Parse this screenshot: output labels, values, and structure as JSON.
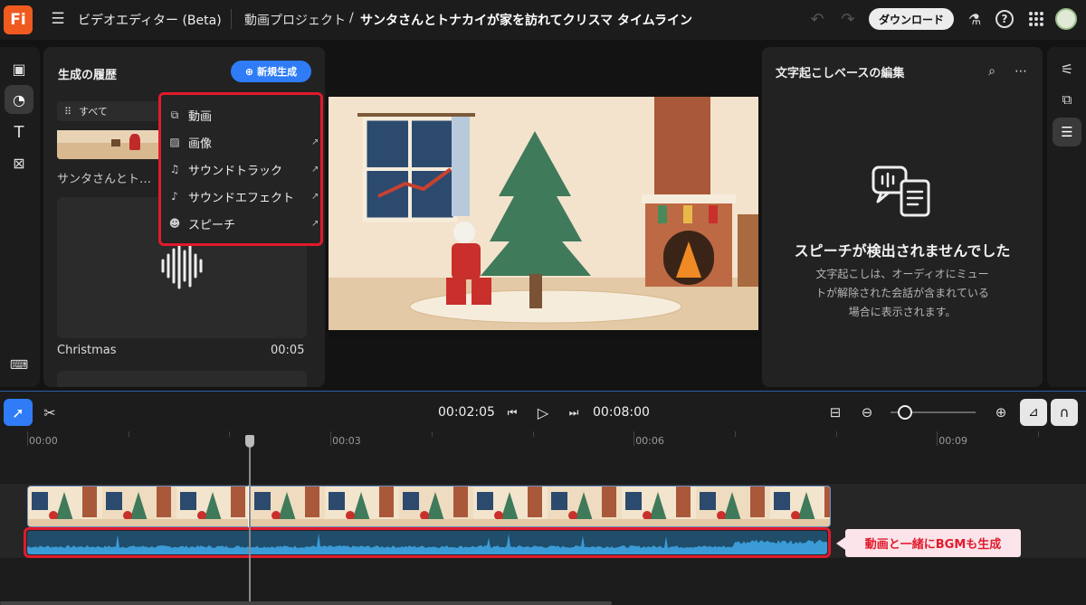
{
  "topbar": {
    "logo": "Fi",
    "app_title": "ビデオエディター (Beta)",
    "project_path": "動画プロジェクト",
    "separator": "/",
    "project_name": "サンタさんとトナカイが家を訪れてクリスマ タイムライン",
    "download_label": "ダウンロード"
  },
  "left_panel": {
    "title": "生成の履歴",
    "new_button_label": "新規生成",
    "filter_label": "すべて",
    "item1_title": "サンタさんとト…",
    "item2_title": "Christmas",
    "item2_duration": "00:05"
  },
  "dropdown": {
    "items": [
      {
        "label": "動画",
        "icon": "video-plus-icon"
      },
      {
        "label": "画像",
        "icon": "image-icon"
      },
      {
        "label": "サウンドトラック",
        "icon": "music-note-icon"
      },
      {
        "label": "サウンドエフェクト",
        "icon": "sparkle-note-icon"
      },
      {
        "label": "スピーチ",
        "icon": "people-icon"
      }
    ]
  },
  "right_panel": {
    "title": "文字起こしベースの編集",
    "empty_title": "スピーチが検出されませんでした",
    "empty_desc_line1": "文字起こしは、オーディオにミュー",
    "empty_desc_line2": "トが解除された会話が含まれている",
    "empty_desc_line3": "場合に表示されます。"
  },
  "transport": {
    "current_time": "00:02:05",
    "total_time": "00:08:00"
  },
  "timeline": {
    "ticks": [
      "00:00",
      "00:03",
      "00:06",
      "00:09"
    ],
    "playhead_time_seconds": 2.2,
    "zoom_level": 0.1
  },
  "annotation": {
    "label": "動画と一緒にBGMも生成"
  },
  "colors": {
    "accent_blue": "#2f7cf6",
    "highlight_red": "#e11a2c",
    "logo_orange": "#ee5a1f",
    "waveform": "#3a9bd6"
  }
}
